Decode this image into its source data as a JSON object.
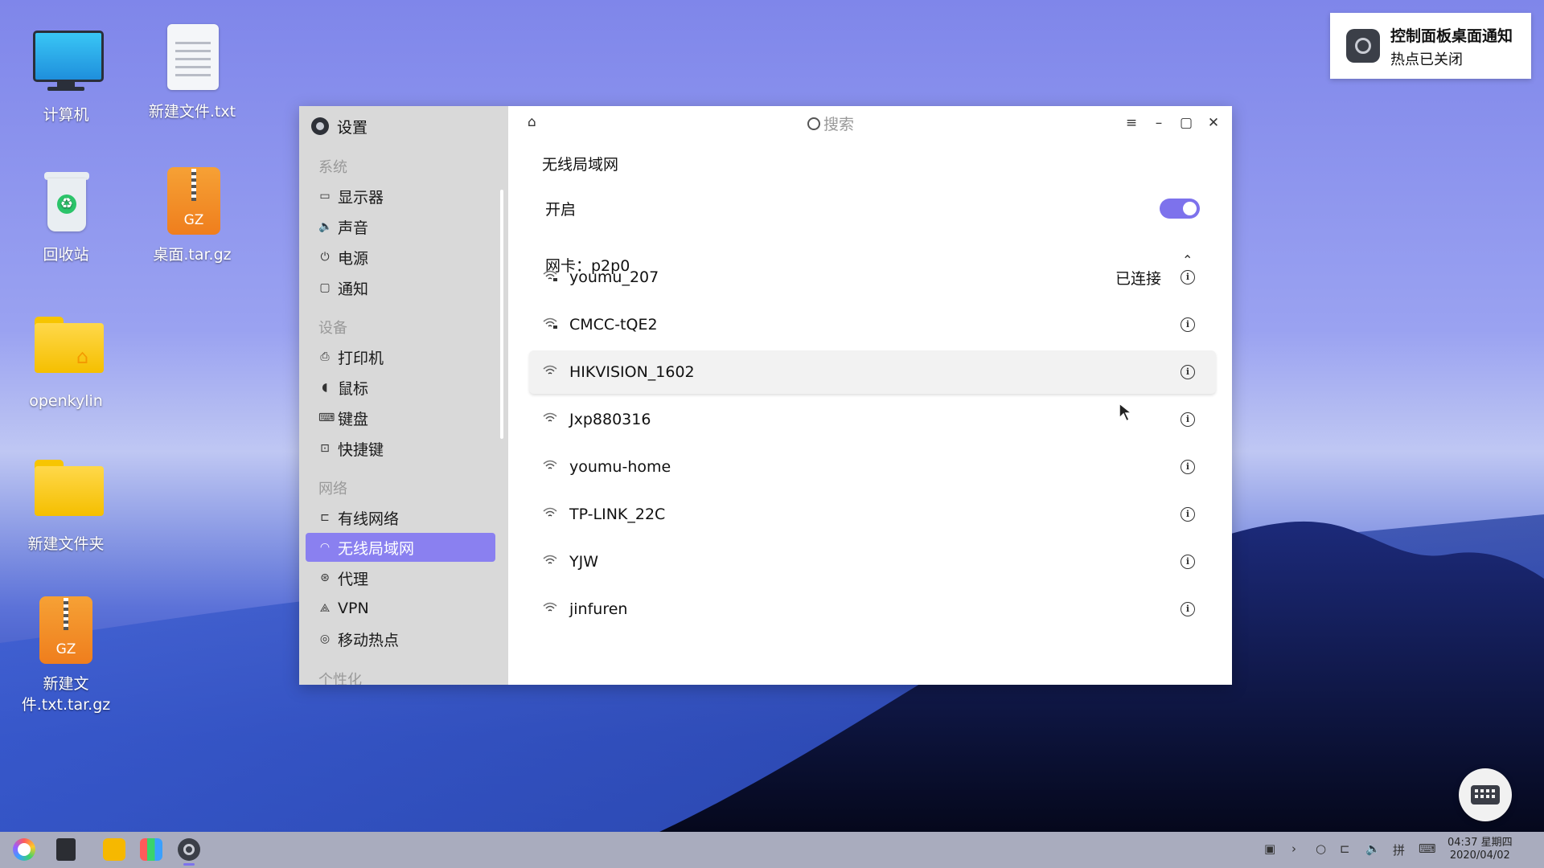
{
  "desktop": {
    "icons": [
      {
        "label": "计算机",
        "icon": "computer-icon"
      },
      {
        "label": "新建文件.txt",
        "icon": "text-file-icon"
      },
      {
        "label": "回收站",
        "icon": "recycle-bin-icon"
      },
      {
        "label": "桌面.tar.gz",
        "icon": "archive-icon",
        "badge": "GZ"
      },
      {
        "label": "openkylin",
        "icon": "home-folder-icon"
      },
      {
        "label": "新建文件夹",
        "icon": "folder-icon"
      },
      {
        "label": "新建文件.txt.tar.gz",
        "icon": "archive-icon",
        "badge": "GZ"
      }
    ]
  },
  "notification": {
    "title": "控制面板桌面通知",
    "message": "热点已关闭"
  },
  "settings": {
    "app_title": "设置",
    "search_placeholder": "搜索",
    "sidebar": {
      "groups": [
        {
          "label": "系统",
          "items": [
            {
              "label": "显示器",
              "icon": "monitor-icon"
            },
            {
              "label": "声音",
              "icon": "speaker-icon"
            },
            {
              "label": "电源",
              "icon": "power-icon"
            },
            {
              "label": "通知",
              "icon": "notification-icon"
            }
          ]
        },
        {
          "label": "设备",
          "items": [
            {
              "label": "打印机",
              "icon": "printer-icon"
            },
            {
              "label": "鼠标",
              "icon": "mouse-icon"
            },
            {
              "label": "键盘",
              "icon": "keyboard-icon"
            },
            {
              "label": "快捷键",
              "icon": "shortcut-icon"
            }
          ]
        },
        {
          "label": "网络",
          "items": [
            {
              "label": "有线网络",
              "icon": "wired-network-icon"
            },
            {
              "label": "无线局域网",
              "icon": "wifi-icon",
              "active": true
            },
            {
              "label": "代理",
              "icon": "proxy-icon"
            },
            {
              "label": "VPN",
              "icon": "vpn-icon"
            },
            {
              "label": "移动热点",
              "icon": "hotspot-icon"
            }
          ]
        },
        {
          "label": "个性化",
          "items": []
        }
      ]
    },
    "main": {
      "title": "无线局域网",
      "enable_label": "开启",
      "enabled": true,
      "adapter_label": "网卡：p2p0",
      "networks": [
        {
          "ssid": "youmu_207",
          "status": "已连接",
          "secured": true
        },
        {
          "ssid": "CMCC-tQE2",
          "status": "",
          "secured": true
        },
        {
          "ssid": "HIKVISION_1602",
          "status": "",
          "secured": false
        },
        {
          "ssid": "Jxp880316",
          "status": "",
          "secured": false
        },
        {
          "ssid": "youmu-home",
          "status": "",
          "secured": false
        },
        {
          "ssid": "TP-LINK_22C",
          "status": "",
          "secured": false
        },
        {
          "ssid": "YJW",
          "status": "",
          "secured": false
        },
        {
          "ssid": "jinfuren",
          "status": "",
          "secured": false
        }
      ]
    }
  },
  "taskbar": {
    "time": "04:37 星期四",
    "date": "2020/04/02",
    "ime": "拼"
  },
  "colors": {
    "accent": "#7d72ec",
    "sidebar_bg": "#d9d9d9",
    "taskbar_bg": "#a9acbe"
  }
}
